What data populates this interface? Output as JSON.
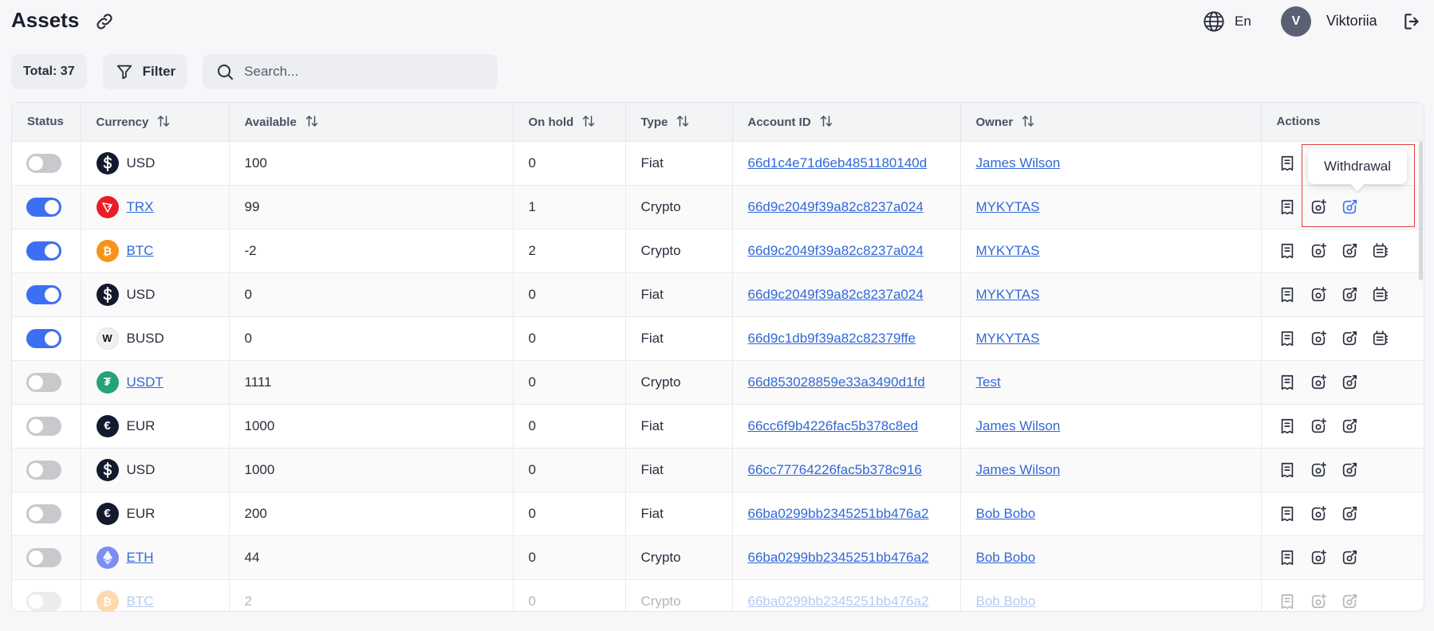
{
  "header": {
    "title": "Assets",
    "language": "En",
    "user_initial": "V",
    "user_name": "Viktoriia"
  },
  "toolbar": {
    "total_label": "Total: 37",
    "filter_label": "Filter",
    "search_placeholder": "Search..."
  },
  "table": {
    "columns": [
      "Status",
      "Currency",
      "Available",
      "On hold",
      "Type",
      "Account ID",
      "Owner",
      "Actions"
    ],
    "rows": [
      {
        "status": false,
        "currency": "USD",
        "coin": "usd",
        "currency_link": false,
        "available": "100",
        "on_hold": "0",
        "type": "Fiat",
        "account_id": "66d1c4e71d6eb4851180140d",
        "owner": "James Wilson",
        "actions": 4
      },
      {
        "status": true,
        "currency": "TRX",
        "coin": "trx",
        "currency_link": true,
        "available": "99",
        "on_hold": "1",
        "type": "Crypto",
        "account_id": "66d9c2049f39a82c8237a024",
        "owner": "MYKYTAS",
        "actions": 3
      },
      {
        "status": true,
        "currency": "BTC",
        "coin": "btc",
        "currency_link": true,
        "available": "-2",
        "on_hold": "2",
        "type": "Crypto",
        "account_id": "66d9c2049f39a82c8237a024",
        "owner": "MYKYTAS",
        "actions": 4
      },
      {
        "status": true,
        "currency": "USD",
        "coin": "usd",
        "currency_link": false,
        "available": "0",
        "on_hold": "0",
        "type": "Fiat",
        "account_id": "66d9c2049f39a82c8237a024",
        "owner": "MYKYTAS",
        "actions": 4
      },
      {
        "status": true,
        "currency": "BUSD",
        "coin": "busd",
        "currency_link": false,
        "available": "0",
        "on_hold": "0",
        "type": "Fiat",
        "account_id": "66d9c1db9f39a82c82379ffe",
        "owner": "MYKYTAS",
        "actions": 4
      },
      {
        "status": false,
        "currency": "USDT",
        "coin": "usdt",
        "currency_link": true,
        "available": "1111",
        "on_hold": "0",
        "type": "Crypto",
        "account_id": "66d853028859e33a3490d1fd",
        "owner": "Test",
        "actions": 3
      },
      {
        "status": false,
        "currency": "EUR",
        "coin": "eur",
        "currency_link": false,
        "available": "1000",
        "on_hold": "0",
        "type": "Fiat",
        "account_id": "66cc6f9b4226fac5b378c8ed",
        "owner": "James Wilson",
        "actions": 3
      },
      {
        "status": false,
        "currency": "USD",
        "coin": "usd",
        "currency_link": false,
        "available": "1000",
        "on_hold": "0",
        "type": "Fiat",
        "account_id": "66cc77764226fac5b378c916",
        "owner": "James Wilson",
        "actions": 3
      },
      {
        "status": false,
        "currency": "EUR",
        "coin": "eur",
        "currency_link": false,
        "available": "200",
        "on_hold": "0",
        "type": "Fiat",
        "account_id": "66ba0299bb2345251bb476a2",
        "owner": "Bob Bobo",
        "actions": 3
      },
      {
        "status": false,
        "currency": "ETH",
        "coin": "eth",
        "currency_link": true,
        "available": "44",
        "on_hold": "0",
        "type": "Crypto",
        "account_id": "66ba0299bb2345251bb476a2",
        "owner": "Bob Bobo",
        "actions": 3
      },
      {
        "status": false,
        "currency": "BTC",
        "coin": "btc",
        "currency_link": true,
        "available": "2",
        "on_hold": "0",
        "type": "Crypto",
        "account_id": "66ba0299bb2345251bb476a2",
        "owner": "Bob Bobo",
        "actions": 3,
        "faded": true
      }
    ]
  },
  "tooltip": {
    "text": "Withdrawal"
  },
  "colors": {
    "accent": "#3d6ff2",
    "link": "#3168d8",
    "toggle_off": "#c8c9cc",
    "highlight": "#e04040"
  },
  "icons": {
    "copy_link": "link-icon",
    "language": "globe-icon",
    "logout": "logout-icon",
    "filter": "filter-icon",
    "search": "search-icon",
    "sort": "sort-icon",
    "action_1": "statement-icon",
    "action_2": "deposit-icon",
    "action_3": "withdrawal-icon",
    "action_4": "transactions-icon"
  }
}
